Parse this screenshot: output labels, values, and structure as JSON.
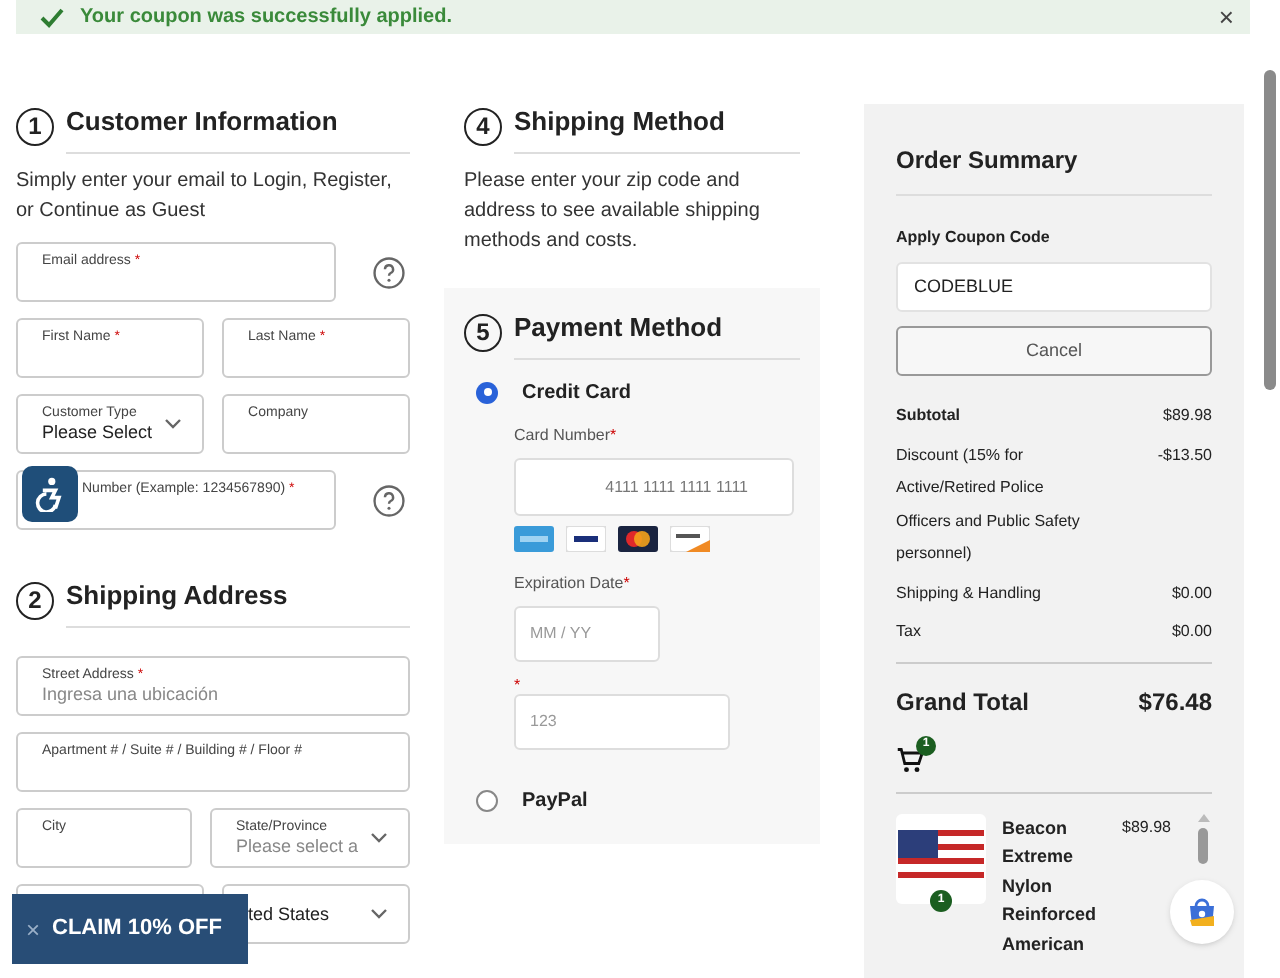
{
  "banner": {
    "message": "Your coupon was successfully applied.",
    "close": "×"
  },
  "customer": {
    "step": "1",
    "title": "Customer Information",
    "intro": "Simply enter your email to Login, Register, or Continue as Guest",
    "rows": [
      [
        {
          "kind": "input",
          "label": "Email address",
          "required": "*",
          "help": true
        }
      ],
      [
        {
          "kind": "input",
          "label": "First Name",
          "required": "*"
        },
        {
          "kind": "input",
          "label": "Last Name",
          "required": "*"
        }
      ],
      [
        {
          "kind": "select",
          "label": "Customer Type",
          "value": "Please Select"
        },
        {
          "kind": "input",
          "label": "Company"
        }
      ],
      [
        {
          "kind": "phone",
          "label": "Number (Example: 1234567890)",
          "required": "*",
          "help": true
        }
      ]
    ]
  },
  "shipping_address": {
    "step": "2",
    "title": "Shipping Address",
    "rows": [
      [
        {
          "kind": "input",
          "label": "Street Address",
          "required": "*",
          "placeholder": "Ingresa una ubicación"
        }
      ],
      [
        {
          "kind": "input",
          "label": "Apartment # / Suite # / Building # / Floor #"
        }
      ],
      [
        {
          "kind": "input",
          "label": "City"
        },
        {
          "kind": "select",
          "label": "State/Province",
          "placeholder": "Please select a"
        }
      ],
      [
        {
          "kind": "input"
        },
        {
          "kind": "select",
          "value": "ted States"
        }
      ]
    ]
  },
  "shipping_method": {
    "step": "4",
    "title": "Shipping Method",
    "text": "Please enter your zip code and address to see available shipping methods and costs."
  },
  "payment": {
    "step": "5",
    "title": "Payment Method",
    "methods": [
      {
        "label": "Credit Card",
        "selected": true,
        "card_number": {
          "label": "Card Number",
          "required": "*",
          "placeholder": "4111 1111 1111 1111"
        },
        "expiration": {
          "label": "Expiration Date",
          "required": "*",
          "placeholder": "MM / YY"
        },
        "cvv": {
          "required": "*",
          "placeholder": "123"
        }
      },
      {
        "label": "PayPal",
        "selected": false
      }
    ]
  },
  "order_summary": {
    "title": "Order Summary",
    "coupon_label": "Apply Coupon Code",
    "coupon_value": "CODEBLUE",
    "cancel": "Cancel",
    "lines": [
      {
        "label": "Subtotal",
        "amount": "$89.98",
        "bold": true
      },
      {
        "label": "Discount (15% for Active/Retired Police Officers and Public Safety personnel)",
        "amount": "-$13.50",
        "bold": false
      },
      {
        "label": "Shipping & Handling",
        "amount": "$0.00",
        "bold": false
      },
      {
        "label": "Tax",
        "amount": "$0.00",
        "bold": false
      }
    ],
    "grand_total_label": "Grand Total",
    "grand_total": "$76.48",
    "cart_count": "1",
    "items": [
      {
        "name": "Beacon Extreme Nylon Reinforced American",
        "price": "$89.98",
        "quantity": "1"
      }
    ]
  },
  "promo": {
    "close": "×",
    "label": "CLAIM 10% OFF"
  }
}
